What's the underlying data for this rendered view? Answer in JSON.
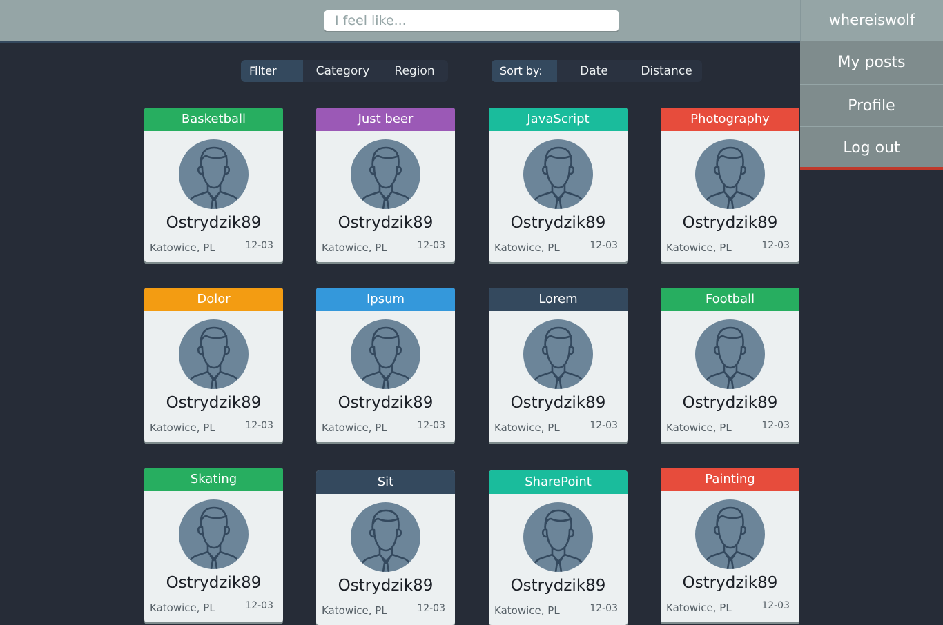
{
  "search": {
    "placeholder": "I feel like..."
  },
  "user_menu": {
    "username": "whereiswolf",
    "items": [
      "My posts",
      "Profile",
      "Log out"
    ],
    "accent": "#c0392b"
  },
  "filter": {
    "label": "Filter by:",
    "options": [
      "Category",
      "Region"
    ]
  },
  "sort": {
    "label": "Sort by:",
    "options": [
      "Date",
      "Distance"
    ]
  },
  "cards": [
    {
      "category": "Basketball",
      "color": "#27ae60",
      "name": "Ostrydzik89",
      "location": "Katowice, PL",
      "date": "12-03"
    },
    {
      "category": "Just beer",
      "color": "#9b59b6",
      "name": "Ostrydzik89",
      "location": "Katowice, PL",
      "date": "12-03"
    },
    {
      "category": "JavaScript",
      "color": "#1abc9c",
      "name": "Ostrydzik89",
      "location": "Katowice, PL",
      "date": "12-03"
    },
    {
      "category": "Photography",
      "color": "#e74c3c",
      "name": "Ostrydzik89",
      "location": "Katowice, PL",
      "date": "12-03"
    },
    {
      "category": "Dolor",
      "color": "#f39c12",
      "name": "Ostrydzik89",
      "location": "Katowice, PL",
      "date": "12-03"
    },
    {
      "category": "Ipsum",
      "color": "#3498db",
      "name": "Ostrydzik89",
      "location": "Katowice, PL",
      "date": "12-03"
    },
    {
      "category": "Lorem",
      "color": "#34495e",
      "name": "Ostrydzik89",
      "location": "Katowice, PL",
      "date": "12-03"
    },
    {
      "category": "Football",
      "color": "#27ae60",
      "name": "Ostrydzik89",
      "location": "Katowice, PL",
      "date": "12-03"
    },
    {
      "category": "Skating",
      "color": "#27ae60",
      "name": "Ostrydzik89",
      "location": "Katowice, PL",
      "date": "12-03"
    },
    {
      "category": "Sit",
      "color": "#34495e",
      "name": "Ostrydzik89",
      "location": "Katowice, PL",
      "date": "12-03"
    },
    {
      "category": "SharePoint",
      "color": "#1abc9c",
      "name": "Ostrydzik89",
      "location": "Katowice, PL",
      "date": "12-03"
    },
    {
      "category": "Painting",
      "color": "#e74c3c",
      "name": "Ostrydzik89",
      "location": "Katowice, PL",
      "date": "12-03"
    }
  ],
  "avatar_icon": "user-silhouette-icon"
}
